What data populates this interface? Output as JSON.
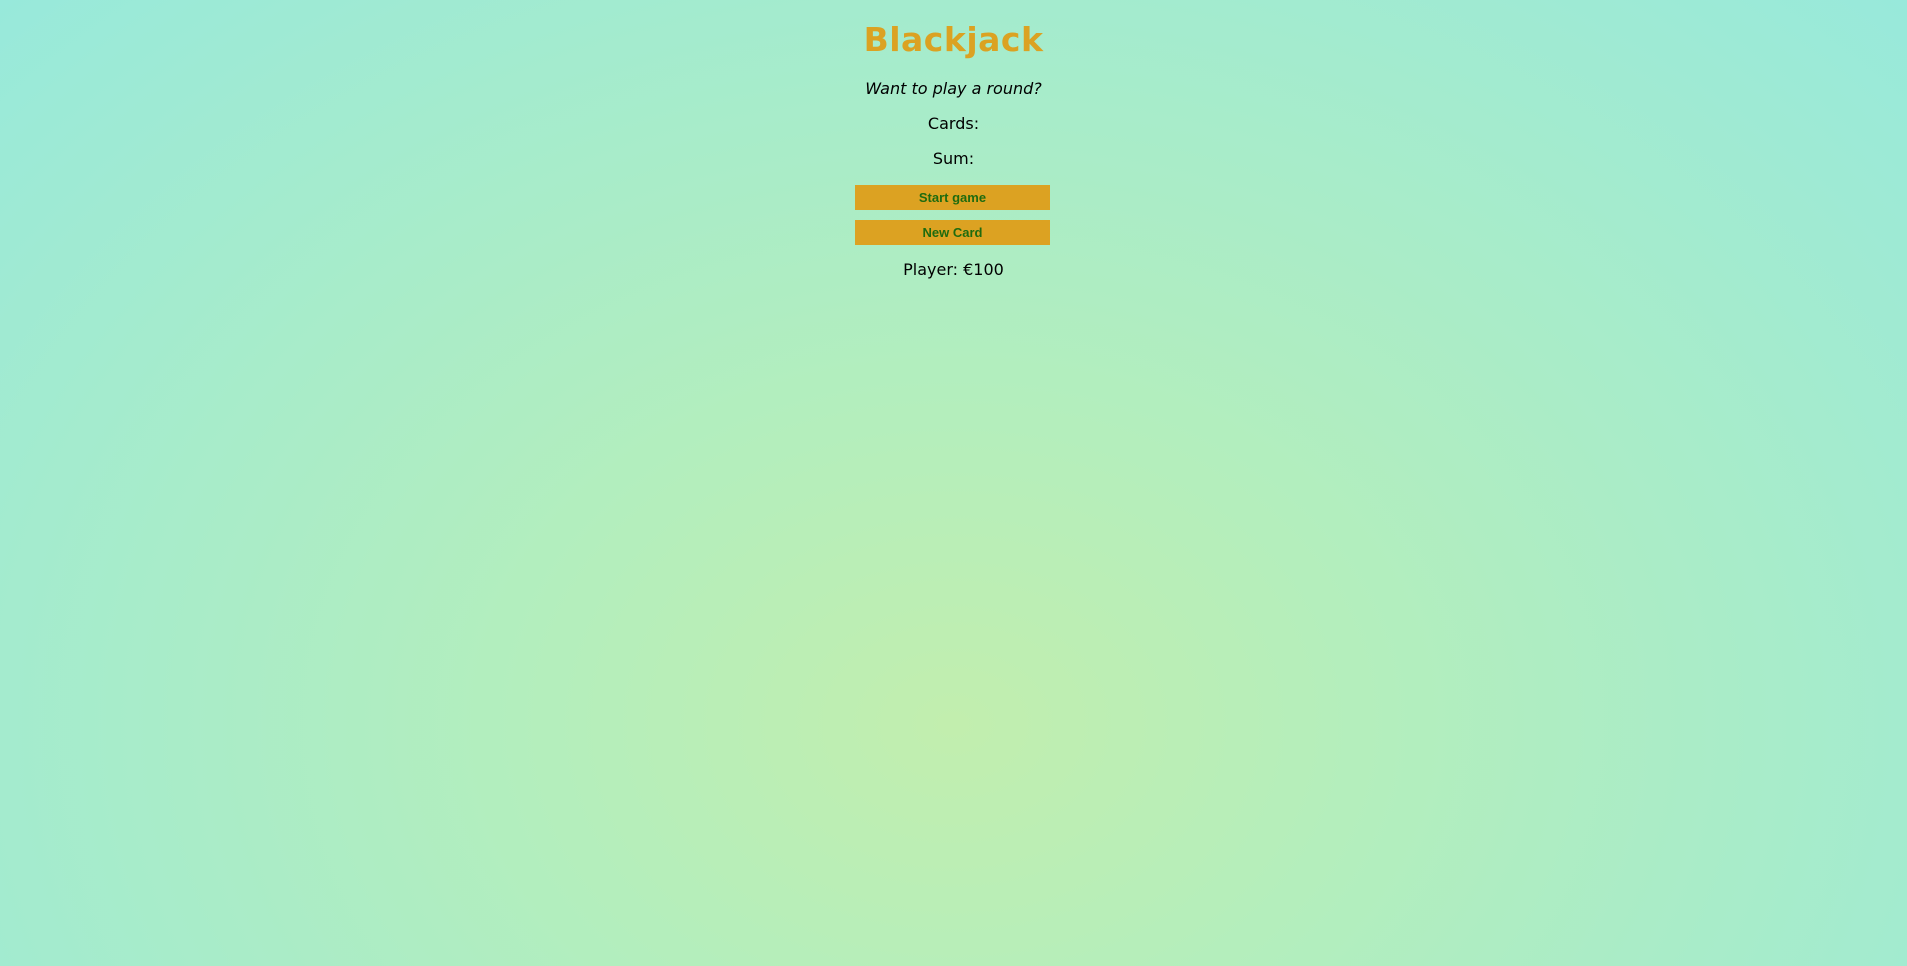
{
  "title": "Blackjack",
  "message": "Want to play a round?",
  "cards_label": "Cards:",
  "sum_label": "Sum:",
  "buttons": {
    "start": "Start game",
    "new_card": "New Card"
  },
  "player": "Player: €100",
  "colors": {
    "accent": "#dba222",
    "button_text": "#1f6b0f"
  }
}
